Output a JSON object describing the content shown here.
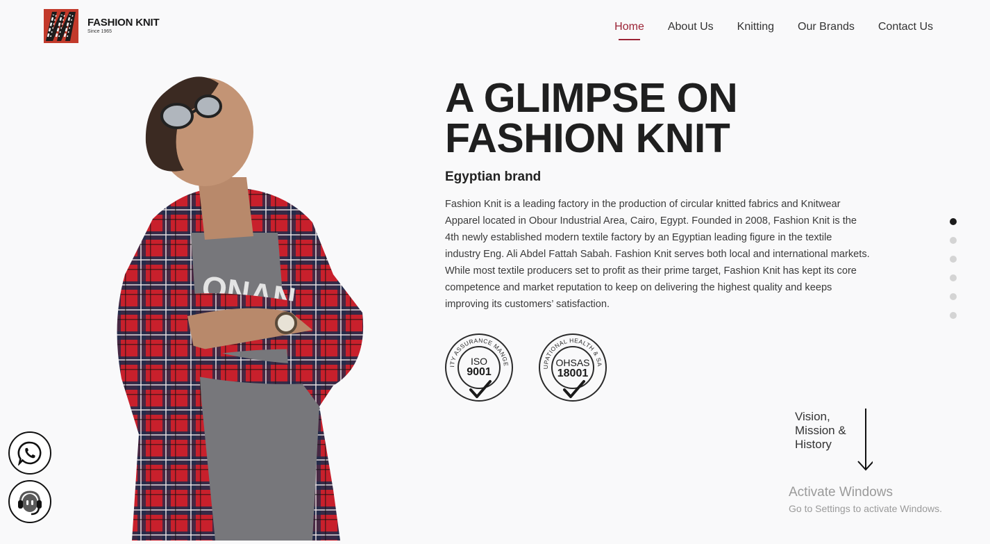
{
  "brand": {
    "name": "FASHION KNIT",
    "since": "Since 1965"
  },
  "nav": {
    "items": [
      {
        "label": "Home"
      },
      {
        "label": "About Us"
      },
      {
        "label": "Knitting"
      },
      {
        "label": "Our Brands"
      },
      {
        "label": "Contact Us"
      }
    ],
    "active_index": 0
  },
  "hero": {
    "title_line1": "A GLIMPSE ON",
    "title_line2": "FASHION KNIT",
    "subtitle": "Egyptian brand",
    "description": "Fashion Knit is a leading factory in the production of circular knitted fabrics and Knitwear Apparel located in Obour Industrial Area, Cairo, Egypt. Founded in 2008, Fashion Knit is the 4th newly established modern textile factory by an Egyptian leading figure in the textile industry Eng. Ali Abdel Fattah Sabah. Fashion Knit serves both local and international markets. While most textile producers set to profit as their prime target, Fashion Knit has kept its core competence and market reputation to keep on delivering the highest quality and keeps improving its customers’ satisfaction."
  },
  "certifications": [
    {
      "arc": "QUALITY ASSURANCE MANGEMENT",
      "line1": "ISO",
      "line2": "9001"
    },
    {
      "arc": "OCCUPATIONAL HEALTH & SAFETY",
      "line1": "OHSAS",
      "line2": "18001"
    }
  ],
  "slider": {
    "dot_count": 6,
    "active_index": 0
  },
  "scroll_hint": {
    "line1": "Vision,",
    "line2": "Mission &",
    "line3": "History"
  },
  "floating_buttons": {
    "whatsapp_icon": "whatsapp-icon",
    "support_icon": "headset-icon"
  },
  "watermark": {
    "title": "Activate Windows",
    "subtitle": "Go to Settings to activate Windows."
  },
  "colors": {
    "accent": "#9b2335",
    "logo_red": "#c23a2b",
    "dot_active": "#1b1b1b",
    "dot_inactive": "#d4d4d4"
  }
}
